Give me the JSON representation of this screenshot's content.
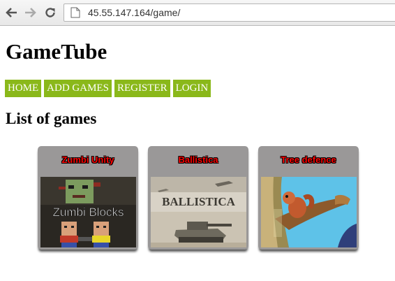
{
  "browser": {
    "back_icon": "back-arrow-icon",
    "forward_icon": "forward-arrow-icon",
    "reload_icon": "reload-icon",
    "page_icon": "document-icon",
    "url": "45.55.147.164/game/"
  },
  "site": {
    "title": "GameTube",
    "accent_color": "#8ab81a",
    "menu": [
      "HOME",
      "ADD GAMES",
      "REGISTER",
      "LOGIN"
    ]
  },
  "main": {
    "heading": "List of games",
    "games": [
      {
        "title": "Zumbi Unity",
        "thumb_text": "Zumbi Blocks"
      },
      {
        "title": "Ballistica",
        "thumb_text": "BALLISTICA"
      },
      {
        "title": "Tree defence",
        "thumb_text": ""
      }
    ]
  }
}
